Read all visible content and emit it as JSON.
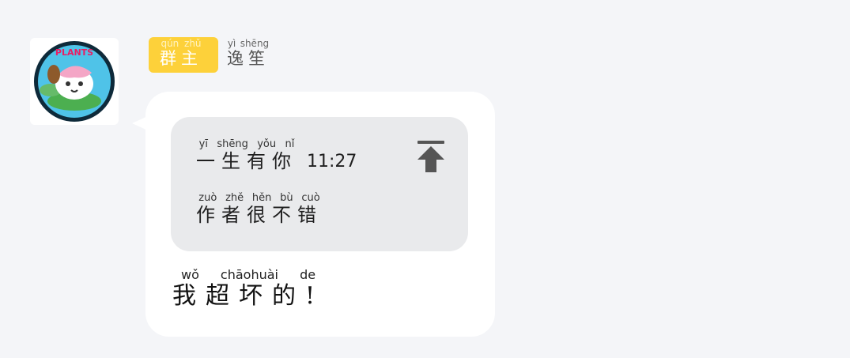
{
  "sender": {
    "role_badge": {
      "text": "群主",
      "pinyin": "qún zhǔ",
      "color": "#fdd13a"
    },
    "name": {
      "text": "逸笙",
      "pinyin": "yì shēng"
    },
    "avatar_icon": "cartoon-cat-avatar-icon",
    "avatar_logo_text": "PLANTS"
  },
  "message": {
    "quote": {
      "author": {
        "text": "一生有你",
        "pinyin": "yī shēng yǒu nǐ"
      },
      "time": "11:27",
      "content": {
        "text": "作者很不错",
        "pinyin": "zuò zhě hěn bù cuò"
      },
      "pin_icon": "pin-to-top-icon"
    },
    "body": {
      "text": "我超坏的!",
      "pinyin": "wǒ chāohuài de"
    }
  },
  "colors": {
    "background": "#f4f5f8",
    "bubble": "#ffffff",
    "quote_bg": "#e9eaec",
    "badge": "#fdd13a"
  }
}
